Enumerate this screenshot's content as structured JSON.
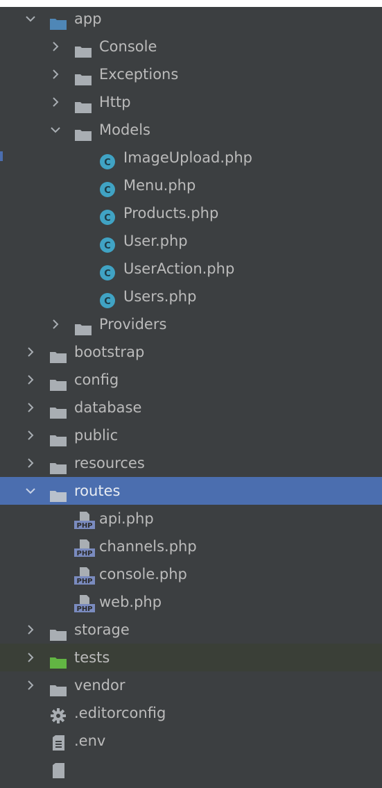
{
  "colors": {
    "background": "#3c3f41",
    "selection": "#4b6eaf",
    "folder": "#a9aeb3",
    "folder_open": "#4f87b7",
    "test_folder": "#62b543",
    "class_icon": "#40a3c4",
    "php_icon": "#7a8bbf"
  },
  "tree": {
    "items": [
      {
        "label": "app",
        "icon": "folder-open-icon",
        "expanded": true
      },
      {
        "label": "Console",
        "icon": "folder-icon",
        "expanded": false
      },
      {
        "label": "Exceptions",
        "icon": "folder-icon",
        "expanded": false
      },
      {
        "label": "Http",
        "icon": "folder-icon",
        "expanded": false
      },
      {
        "label": "Models",
        "icon": "folder-icon",
        "expanded": true
      },
      {
        "label": "ImageUpload.php",
        "icon": "php-class-icon"
      },
      {
        "label": "Menu.php",
        "icon": "php-class-icon"
      },
      {
        "label": "Products.php",
        "icon": "php-class-icon"
      },
      {
        "label": "User.php",
        "icon": "php-class-icon"
      },
      {
        "label": "UserAction.php",
        "icon": "php-class-icon"
      },
      {
        "label": "Users.php",
        "icon": "php-class-icon"
      },
      {
        "label": "Providers",
        "icon": "folder-icon",
        "expanded": false
      },
      {
        "label": "bootstrap",
        "icon": "folder-icon",
        "expanded": false
      },
      {
        "label": "config",
        "icon": "folder-icon",
        "expanded": false
      },
      {
        "label": "database",
        "icon": "folder-icon",
        "expanded": false
      },
      {
        "label": "public",
        "icon": "folder-icon",
        "expanded": false
      },
      {
        "label": "resources",
        "icon": "folder-icon",
        "expanded": false
      },
      {
        "label": "routes",
        "icon": "folder-open-icon",
        "expanded": true,
        "selected": true
      },
      {
        "label": "api.php",
        "icon": "php-file-icon"
      },
      {
        "label": "channels.php",
        "icon": "php-file-icon"
      },
      {
        "label": "console.php",
        "icon": "php-file-icon"
      },
      {
        "label": "web.php",
        "icon": "php-file-icon"
      },
      {
        "label": "storage",
        "icon": "folder-icon",
        "expanded": false
      },
      {
        "label": "tests",
        "icon": "test-folder-icon",
        "expanded": false
      },
      {
        "label": "vendor",
        "icon": "folder-icon",
        "expanded": false
      },
      {
        "label": ".editorconfig",
        "icon": "gear-icon"
      },
      {
        "label": ".env",
        "icon": "text-file-icon"
      }
    ]
  }
}
